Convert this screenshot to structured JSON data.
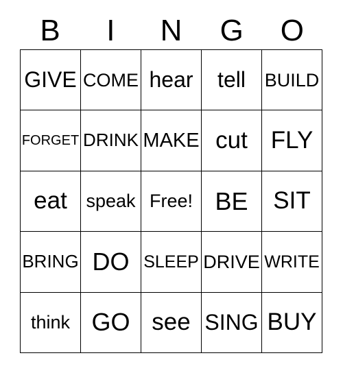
{
  "card": {
    "type": "bingo-card",
    "headers": [
      "B",
      "I",
      "N",
      "G",
      "O"
    ],
    "free_space_label": "Free!",
    "colors": {
      "background": "#ffffff",
      "border": "#000000",
      "text": "#000000"
    },
    "rows": [
      [
        {
          "label": "GIVE"
        },
        {
          "label": "COME"
        },
        {
          "label": "hear"
        },
        {
          "label": "tell"
        },
        {
          "label": "BUILD"
        }
      ],
      [
        {
          "label": "FORGET"
        },
        {
          "label": "DRINK"
        },
        {
          "label": "MAKE"
        },
        {
          "label": "cut"
        },
        {
          "label": "FLY"
        }
      ],
      [
        {
          "label": "eat"
        },
        {
          "label": "speak"
        },
        {
          "label": "Free!"
        },
        {
          "label": "BE"
        },
        {
          "label": "SIT"
        }
      ],
      [
        {
          "label": "BRING"
        },
        {
          "label": "DO"
        },
        {
          "label": "SLEEP"
        },
        {
          "label": "DRIVE"
        },
        {
          "label": "WRITE"
        }
      ],
      [
        {
          "label": "think"
        },
        {
          "label": "GO"
        },
        {
          "label": "see"
        },
        {
          "label": "SING"
        },
        {
          "label": "BUY"
        }
      ]
    ]
  }
}
